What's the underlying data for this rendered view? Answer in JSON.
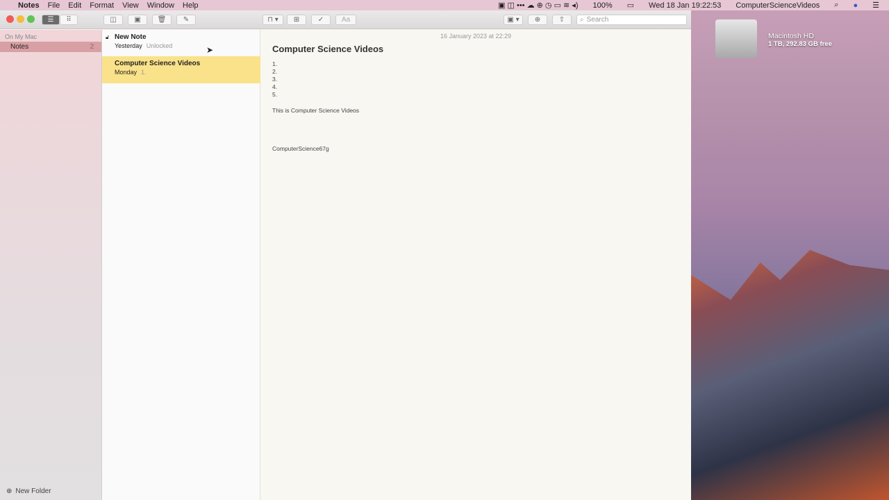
{
  "menubar": {
    "app": "Notes",
    "items": [
      "File",
      "Edit",
      "Format",
      "View",
      "Window",
      "Help"
    ],
    "battery": "100%",
    "clock": "Wed 18 Jan  19:22:53",
    "user": "ComputerScienceVideos"
  },
  "toolbar": {
    "search_placeholder": "Search",
    "format_label": "Aa"
  },
  "sidebar": {
    "section": "On My Mac",
    "folder": "Notes",
    "count": "2",
    "new_folder": "New Folder"
  },
  "notes": [
    {
      "title": "New Note",
      "date": "Yesterday",
      "preview": "Unlocked",
      "locked": true
    },
    {
      "title": "Computer Science Videos",
      "date": "Monday",
      "preview": "1."
    }
  ],
  "editor": {
    "timestamp": "16 January 2023 at 22:29",
    "title": "Computer Science Videos",
    "list": [
      "1.",
      "2.",
      "3.",
      "4.",
      "5."
    ],
    "body": "This is Computer Science Videos",
    "footer": "ComputerScience67g"
  },
  "desktop": {
    "disk_name": "Macintosh HD",
    "disk_info": "1 TB, 292.83 GB free"
  }
}
